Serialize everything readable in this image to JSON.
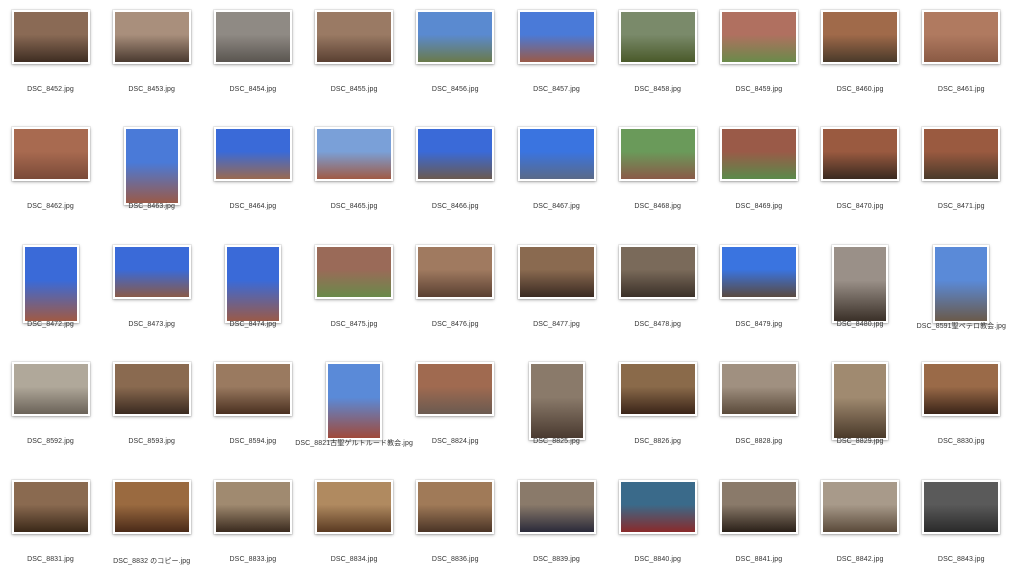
{
  "files": [
    {
      "name": "DSC_8452.jpg",
      "orientation": "landscape",
      "colors": [
        "#8a6a55",
        "#3e2d22"
      ]
    },
    {
      "name": "DSC_8453.jpg",
      "orientation": "landscape",
      "colors": [
        "#a98f7c",
        "#4a3a30"
      ]
    },
    {
      "name": "DSC_8454.jpg",
      "orientation": "landscape",
      "colors": [
        "#8f8a84",
        "#5a5550"
      ]
    },
    {
      "name": "DSC_8455.jpg",
      "orientation": "landscape",
      "colors": [
        "#9a7a64",
        "#5a4032"
      ]
    },
    {
      "name": "DSC_8456.jpg",
      "orientation": "landscape",
      "colors": [
        "#5a8ad0",
        "#6a7a4a"
      ]
    },
    {
      "name": "DSC_8457.jpg",
      "orientation": "landscape",
      "colors": [
        "#4a7ad8",
        "#9a5a48"
      ]
    },
    {
      "name": "DSC_8458.jpg",
      "orientation": "landscape",
      "colors": [
        "#7a8a6a",
        "#4a5a2a"
      ]
    },
    {
      "name": "DSC_8459.jpg",
      "orientation": "landscape",
      "colors": [
        "#b07060",
        "#6a8a4a"
      ]
    },
    {
      "name": "DSC_8460.jpg",
      "orientation": "landscape",
      "colors": [
        "#a06a4a",
        "#4a3a2a"
      ]
    },
    {
      "name": "DSC_8461.jpg",
      "orientation": "landscape",
      "colors": [
        "#b07a60",
        "#8a5a44"
      ]
    },
    {
      "name": "DSC_8462.jpg",
      "orientation": "landscape",
      "colors": [
        "#a86a50",
        "#7a4a38"
      ]
    },
    {
      "name": "DSC_8463.jpg",
      "orientation": "portrait",
      "colors": [
        "#4a7ad8",
        "#9a5a48"
      ]
    },
    {
      "name": "DSC_8464.jpg",
      "orientation": "landscape",
      "colors": [
        "#3a6ad8",
        "#9a6a50"
      ]
    },
    {
      "name": "DSC_8465.jpg",
      "orientation": "landscape",
      "colors": [
        "#7aa0d8",
        "#a05a44"
      ]
    },
    {
      "name": "DSC_8466.jpg",
      "orientation": "landscape",
      "colors": [
        "#3a6ad8",
        "#6a5a50"
      ]
    },
    {
      "name": "DSC_8467.jpg",
      "orientation": "landscape",
      "colors": [
        "#3a74e0",
        "#5a6a88"
      ]
    },
    {
      "name": "DSC_8468.jpg",
      "orientation": "landscape",
      "colors": [
        "#6a9a5a",
        "#8a5a48"
      ]
    },
    {
      "name": "DSC_8469.jpg",
      "orientation": "landscape",
      "colors": [
        "#9a5a48",
        "#5a8a4a"
      ]
    },
    {
      "name": "DSC_8470.jpg",
      "orientation": "landscape",
      "colors": [
        "#9a5a40",
        "#3a2a20"
      ]
    },
    {
      "name": "DSC_8471.jpg",
      "orientation": "landscape",
      "colors": [
        "#9a5a40",
        "#4a3a2a"
      ]
    },
    {
      "name": "DSC_8472.jpg",
      "orientation": "portrait",
      "colors": [
        "#3a6ad8",
        "#a05a44"
      ]
    },
    {
      "name": "DSC_8473.jpg",
      "orientation": "landscape",
      "colors": [
        "#3a6ad8",
        "#8a5a48"
      ]
    },
    {
      "name": "DSC_8474.jpg",
      "orientation": "portrait",
      "colors": [
        "#3a6ad8",
        "#9a5a48"
      ]
    },
    {
      "name": "DSC_8475.jpg",
      "orientation": "landscape",
      "colors": [
        "#9a6a58",
        "#6a8a4a"
      ]
    },
    {
      "name": "DSC_8476.jpg",
      "orientation": "landscape",
      "colors": [
        "#a07a60",
        "#5a4032"
      ]
    },
    {
      "name": "DSC_8477.jpg",
      "orientation": "landscape",
      "colors": [
        "#8a6a50",
        "#3a2a22"
      ]
    },
    {
      "name": "DSC_8478.jpg",
      "orientation": "landscape",
      "colors": [
        "#7a6a5a",
        "#3a3028"
      ]
    },
    {
      "name": "DSC_8479.jpg",
      "orientation": "landscape",
      "colors": [
        "#3a74e0",
        "#5a4a40"
      ]
    },
    {
      "name": "DSC_8480.jpg",
      "orientation": "portrait",
      "colors": [
        "#9a9088",
        "#3a3028"
      ]
    },
    {
      "name": "DSC_8591聖ペテロ教会.jpg",
      "orientation": "portrait",
      "colors": [
        "#5a8ad8",
        "#6a5a4a"
      ]
    },
    {
      "name": "DSC_8592.jpg",
      "orientation": "landscape",
      "colors": [
        "#b0a89a",
        "#6a6258"
      ]
    },
    {
      "name": "DSC_8593.jpg",
      "orientation": "landscape",
      "colors": [
        "#8a6a50",
        "#3a2a20"
      ]
    },
    {
      "name": "DSC_8594.jpg",
      "orientation": "landscape",
      "colors": [
        "#9a7a60",
        "#4a3020"
      ]
    },
    {
      "name": "DSC_8821古聖ゲルトルード教会.jpg",
      "orientation": "portrait",
      "colors": [
        "#5a8ad8",
        "#a04a3a"
      ]
    },
    {
      "name": "DSC_8824.jpg",
      "orientation": "landscape",
      "colors": [
        "#a06a50",
        "#6a5a50"
      ]
    },
    {
      "name": "DSC_8825.jpg",
      "orientation": "portrait",
      "colors": [
        "#8a7a6a",
        "#4a3a30"
      ]
    },
    {
      "name": "DSC_8826.jpg",
      "orientation": "landscape",
      "colors": [
        "#8a6a4a",
        "#3a2418"
      ]
    },
    {
      "name": "DSC_8828.jpg",
      "orientation": "landscape",
      "colors": [
        "#a09080",
        "#5a4a3a"
      ]
    },
    {
      "name": "DSC_8829.jpg",
      "orientation": "portrait",
      "colors": [
        "#a08a70",
        "#4a3a2a"
      ]
    },
    {
      "name": "DSC_8830.jpg",
      "orientation": "landscape",
      "colors": [
        "#9a6a48",
        "#3a2418"
      ]
    },
    {
      "name": "DSC_8831.jpg",
      "orientation": "landscape",
      "colors": [
        "#8a6a50",
        "#3a2818"
      ]
    },
    {
      "name": "DSC_8832 のコピー.jpg",
      "orientation": "landscape",
      "colors": [
        "#9a6a40",
        "#4a2a18"
      ]
    },
    {
      "name": "DSC_8833.jpg",
      "orientation": "landscape",
      "colors": [
        "#a08a70",
        "#3a2a1e"
      ]
    },
    {
      "name": "DSC_8834.jpg",
      "orientation": "landscape",
      "colors": [
        "#b08a60",
        "#5a3a22"
      ]
    },
    {
      "name": "DSC_8836.jpg",
      "orientation": "landscape",
      "colors": [
        "#a07a58",
        "#4a3426"
      ]
    },
    {
      "name": "DSC_8839.jpg",
      "orientation": "landscape",
      "colors": [
        "#8a7a6a",
        "#2a2a3a"
      ]
    },
    {
      "name": "DSC_8840.jpg",
      "orientation": "landscape",
      "colors": [
        "#3a6a8a",
        "#8a2a2a"
      ]
    },
    {
      "name": "DSC_8841.jpg",
      "orientation": "landscape",
      "colors": [
        "#8a7a6a",
        "#2a2018"
      ]
    },
    {
      "name": "DSC_8842.jpg",
      "orientation": "landscape",
      "colors": [
        "#a89a8a",
        "#5a4a3a"
      ]
    },
    {
      "name": "DSC_8843.jpg",
      "orientation": "landscape",
      "colors": [
        "#5a5a5a",
        "#2a2a2a"
      ]
    }
  ]
}
